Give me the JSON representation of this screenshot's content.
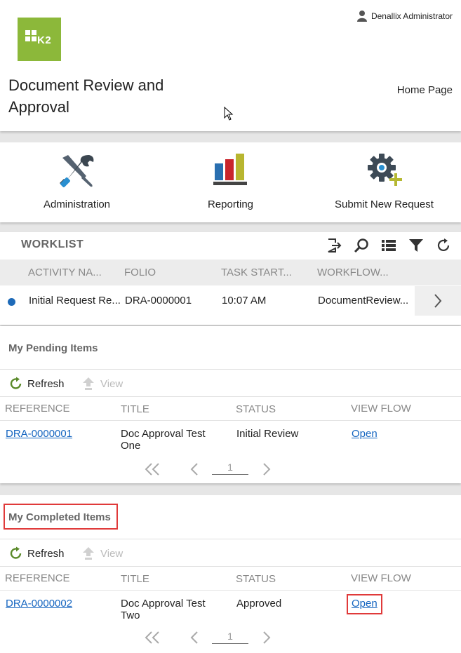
{
  "header": {
    "user_name": "Denallix Administrator",
    "app_title": "Document Review and Approval",
    "home_link": "Home Page",
    "logo_text": "K2"
  },
  "tiles": [
    {
      "label": "Administration"
    },
    {
      "label": "Reporting"
    },
    {
      "label": "Submit New Request"
    }
  ],
  "worklist": {
    "title": "WORKLIST",
    "columns": [
      "ACTIVITY NA...",
      "FOLIO",
      "TASK START...",
      "WORKFLOW..."
    ],
    "rows": [
      {
        "activity": "Initial Request Re...",
        "folio": "DRA-0000001",
        "task_start": "10:07 AM",
        "workflow": "DocumentReview..."
      }
    ]
  },
  "pending": {
    "title": "My Pending Items",
    "refresh_label": "Refresh",
    "view_label": "View",
    "columns": [
      "REFERENCE",
      "TITLE",
      "STATUS",
      "VIEW FLOW"
    ],
    "rows": [
      {
        "reference": "DRA-0000001",
        "title_line1": "Doc Approval Test",
        "title_line2": "One",
        "status": "Initial Review",
        "view_flow": "Open"
      }
    ],
    "page": "1"
  },
  "completed": {
    "title": "My Completed Items",
    "refresh_label": "Refresh",
    "view_label": "View",
    "columns": [
      "REFERENCE",
      "TITLE",
      "STATUS",
      "VIEW FLOW"
    ],
    "rows": [
      {
        "reference": "DRA-0000002",
        "title_line1": "Doc Approval Test",
        "title_line2": "Two",
        "status": "Approved",
        "view_flow": "Open"
      }
    ],
    "page": "1"
  },
  "colors": {
    "logo_green": "#8cb83a",
    "link_blue": "#1565c0",
    "highlight_red": "#e03a3a",
    "status_dot": "#1e6ab8"
  },
  "icons": [
    "user-icon",
    "tools-icon",
    "bar-chart-icon",
    "gear-plus-icon",
    "export-icon",
    "search-icon",
    "list-icon",
    "filter-icon",
    "refresh-icon",
    "view-arrow-icon",
    "first-page-icon",
    "prev-page-icon",
    "next-page-icon",
    "chevron-right-icon",
    "mouse-cursor-icon"
  ]
}
